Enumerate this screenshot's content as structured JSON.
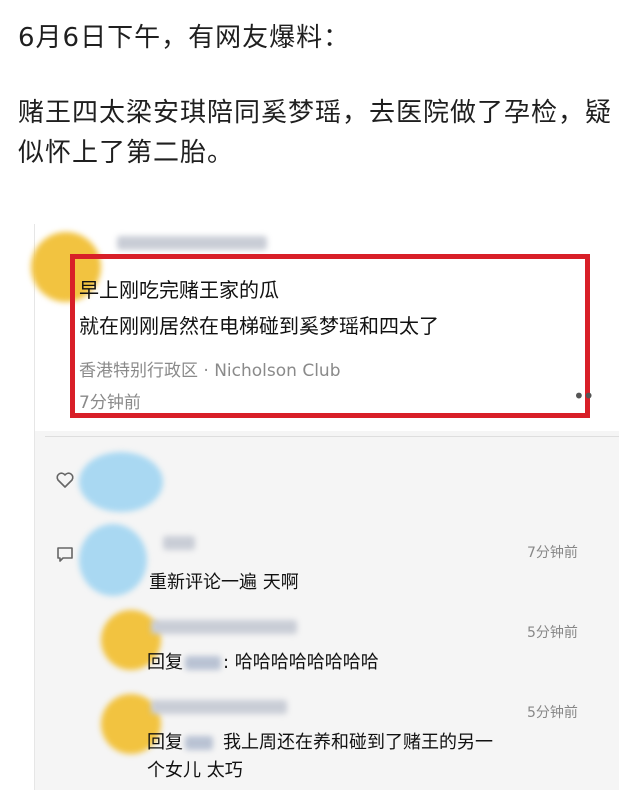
{
  "article": {
    "line1": "6月6日下午，有网友爆料：",
    "line2": "赌王四太梁安琪陪同奚梦瑶，去医院做了孕检，疑似怀上了第二胎。"
  },
  "post": {
    "line1": "早上刚吃完赌王家的瓜",
    "line2": "就在刚刚居然在电梯碰到奚梦瑶和四太了",
    "location": "香港特别行政区 · Nicholson Club",
    "time": "7分钟前",
    "more": "••"
  },
  "comments": [
    {
      "time": "7分钟前",
      "text": "重新评论一遍 天啊"
    },
    {
      "time": "5分钟前",
      "reply_label": "回复",
      "text": ": 哈哈哈哈哈哈哈哈"
    },
    {
      "time": "5分钟前",
      "reply_label": "回复",
      "text": "我上周还在养和碰到了赌王的另一",
      "text2": "个女儿 太巧"
    }
  ],
  "colors": {
    "highlight": "#d81f28",
    "avatar_yellow": "#f2c340",
    "avatar_blue": "#a9d8f2"
  },
  "icons": [
    "heart-icon",
    "comment-icon"
  ]
}
